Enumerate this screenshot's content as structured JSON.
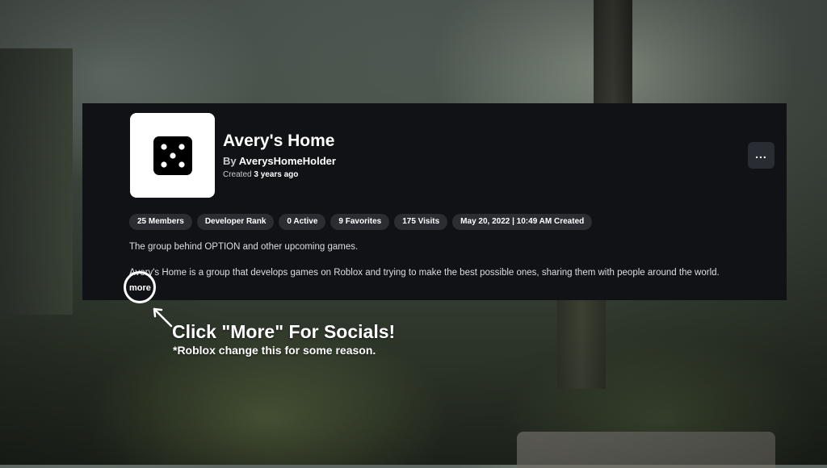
{
  "group": {
    "name": "Avery's Home",
    "owner_prefix": "By",
    "owner_name": "AverysHomeHolder",
    "created_prefix": "Created",
    "created_value": "3 years ago",
    "icon": "dice-five-icon",
    "more_options_label": "..."
  },
  "stats": [
    "25 Members",
    "Developer Rank",
    "0 Active",
    "9 Favorites",
    "175 Visits",
    "May 20, 2022 | 10:49 AM Created"
  ],
  "description": {
    "short": "The group behind OPTION and other upcoming games.",
    "long": "Avery's Home is a group that develops games on Roblox and trying to make the best possible ones, sharing them with people around the world.",
    "more_label": "more"
  },
  "callout": {
    "title": "Click \"More\" For Socials!",
    "note": "*Roblox change this for some reason."
  },
  "colors": {
    "panel": "#111216",
    "pill": "#2b2d33",
    "text": "#ffffff"
  }
}
